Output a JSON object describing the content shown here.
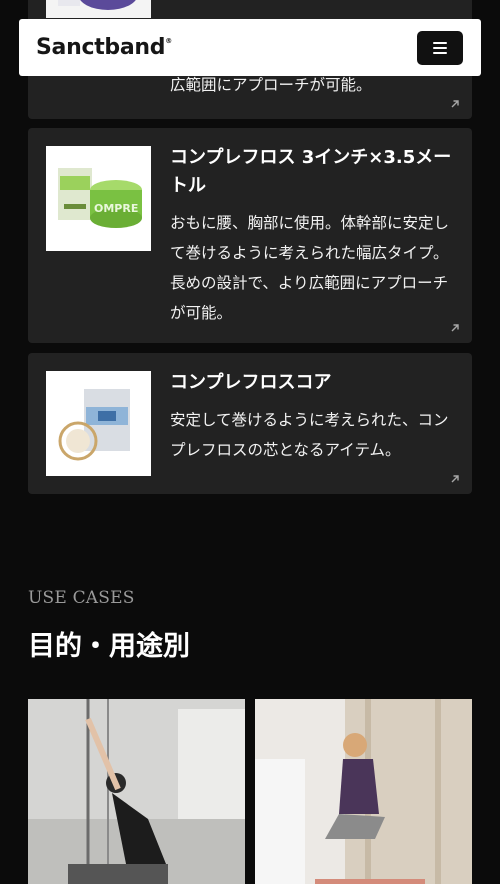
{
  "header": {
    "logo_text": "Sanctband",
    "logo_mark": "®",
    "menu_icon": "hamburger-icon"
  },
  "products": [
    {
      "title": "",
      "description": "広範囲にアプローチが可能。",
      "link_icon": "arrow-up-right-icon"
    },
    {
      "title": "コンプレフロス 3インチ×3.5メートル",
      "description": "おもに腰、胸部に使用。体幹部に安定して巻けるように考えられた幅広タイプ。長めの設計で、より広範囲にアプローチが可能。",
      "link_icon": "arrow-up-right-icon"
    },
    {
      "title": "コンプレフロスコア",
      "description": "安定して巻けるように考えられた、コンプレフロスの芯となるアイテム。",
      "link_icon": "arrow-up-right-icon"
    }
  ],
  "use_cases": {
    "label": "USE CASES",
    "title": "目的・用途別"
  },
  "colors": {
    "background": "#0b0b0b",
    "card": "#222222",
    "header_bg": "#ffffff",
    "band_green": "#7ac142",
    "band_purple": "#5b4a9a"
  }
}
